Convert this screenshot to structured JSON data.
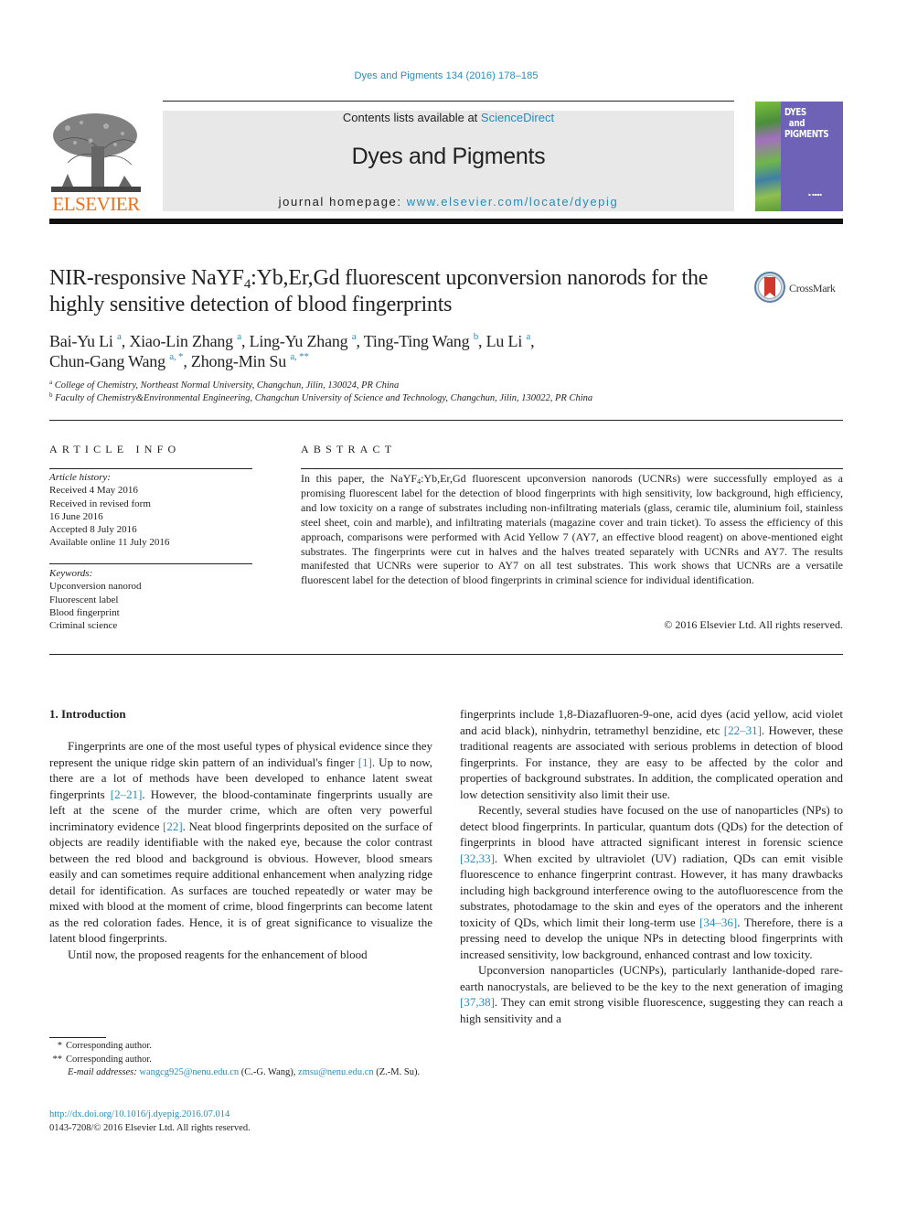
{
  "header": {
    "journal_citation": "Dyes and Pigments 134 (2016) 178–185",
    "contents_prefix": "Contents lists available at ",
    "contents_link": "ScienceDirect",
    "journal_name": "Dyes and Pigments",
    "homepage_prefix": "journal homepage: ",
    "homepage_link": "www.elsevier.com/locate/dyepig",
    "publisher_logo_text": "ELSEVIER",
    "cover_title_lines": [
      "DYES",
      "and",
      "PIGMENTS"
    ],
    "crossmark_label": "CrossMark"
  },
  "article": {
    "title_part1": "NIR-responsive NaYF",
    "title_sub": "4",
    "title_part2": ":Yb,Er,Gd fluorescent upconversion nanorods for the highly sensitive detection of blood fingerprints",
    "authors": [
      {
        "name": "Bai-Yu Li",
        "sup": "a",
        "sep": ", "
      },
      {
        "name": "Xiao-Lin Zhang",
        "sup": "a",
        "sep": ", "
      },
      {
        "name": "Ling-Yu Zhang",
        "sup": "a",
        "sep": ", "
      },
      {
        "name": "Ting-Ting Wang",
        "sup": "b",
        "sep": ", "
      },
      {
        "name": "Lu Li",
        "sup": "a",
        "sep": ","
      },
      {
        "name": "Chun-Gang Wang",
        "sup": "a, *",
        "sep": ", "
      },
      {
        "name": "Zhong-Min Su",
        "sup": "a, **",
        "sep": ""
      }
    ],
    "affiliations": [
      {
        "mark": "a",
        "text": "College of Chemistry, Northeast Normal University, Changchun, Jilin, 130024, PR China"
      },
      {
        "mark": "b",
        "text": "Faculty of Chemistry&Environmental Engineering, Changchun University of Science and Technology, Changchun, Jilin, 130022, PR China"
      }
    ]
  },
  "article_info": {
    "heading": "ARTICLE INFO",
    "history_label": "Article history:",
    "history": [
      "Received 4 May 2016",
      "Received in revised form",
      "16 June 2016",
      "Accepted 8 July 2016",
      "Available online 11 July 2016"
    ],
    "keywords_label": "Keywords:",
    "keywords": [
      "Upconversion nanorod",
      "Fluorescent label",
      "Blood fingerprint",
      "Criminal science"
    ]
  },
  "abstract": {
    "heading": "ABSTRACT",
    "text_part1": "In this paper, the NaYF",
    "text_sub": "4",
    "text_part2": ":Yb,Er,Gd fluorescent upconversion nanorods (UCNRs) were successfully employed as a promising fluorescent label for the detection of blood fingerprints with high sensitivity, low background, high efficiency, and low toxicity on a range of substrates including non-infiltrating materials (glass, ceramic tile, aluminium foil, stainless steel sheet, coin and marble), and infiltrating materials (magazine cover and train ticket). To assess the efficiency of this approach, comparisons were performed with Acid Yellow 7 (AY7, an effective blood reagent) on above-mentioned eight substrates. The fingerprints were cut in halves and the halves treated separately with UCNRs and AY7. The results manifested that UCNRs were superior to AY7 on all test substrates. This work shows that UCNRs are a versatile fluorescent label for the detection of blood fingerprints in criminal science for individual identification.",
    "copyright": "© 2016 Elsevier Ltd. All rights reserved."
  },
  "body": {
    "section_heading": "1.  Introduction",
    "left_paragraphs": [
      [
        {
          "t": "Fingerprints are one of the most useful types of physical evidence since they represent the unique ridge skin pattern of an individual's finger "
        },
        {
          "ref": "[1]"
        },
        {
          "t": ". Up to now, there are a lot of methods have been developed to enhance latent sweat fingerprints "
        },
        {
          "ref": "[2–21]"
        },
        {
          "t": ". However, the blood-contaminate fingerprints usually are left at the scene of the murder crime, which are often very powerful incriminatory evidence "
        },
        {
          "ref": "[22]"
        },
        {
          "t": ". Neat blood fingerprints deposited on the surface of objects are readily identifiable with the naked eye, because the color contrast between the red blood and background is obvious. However, blood smears easily and can sometimes require additional enhancement when analyzing ridge detail for identification. As surfaces are touched repeatedly or water may be mixed with blood at the moment of crime, blood fingerprints can become latent as the red coloration fades. Hence, it is of great significance to visualize the latent blood fingerprints."
        }
      ],
      [
        {
          "t": "Until now, the proposed reagents for the enhancement of blood"
        }
      ]
    ],
    "right_paragraphs": [
      [
        {
          "t": "fingerprints include 1,8-Diazafluoren-9-one, acid dyes (acid yellow, acid violet and acid black), ninhydrin, tetramethyl benzidine, etc "
        },
        {
          "ref": "[22–31]"
        },
        {
          "t": ". However, these traditional reagents are associated with serious problems in detection of blood fingerprints. For instance, they are easy to be affected by the color and properties of background substrates. In addition, the complicated operation and low detection sensitivity also limit their use."
        }
      ],
      [
        {
          "t": "Recently, several studies have focused on the use of nanoparticles (NPs) to detect blood fingerprints. In particular, quantum dots (QDs) for the detection of fingerprints in blood have attracted significant interest in forensic science "
        },
        {
          "ref": "[32,33]"
        },
        {
          "t": ". When excited by ultraviolet (UV) radiation, QDs can emit visible fluorescence to enhance fingerprint contrast. However, it has many drawbacks including high background interference owing to the autofluorescence from the substrates, photodamage to the skin and eyes of the operators and the inherent toxicity of QDs, which limit their long-term use "
        },
        {
          "ref": "[34–36]"
        },
        {
          "t": ". Therefore, there is a pressing need to develop the unique NPs in detecting blood fingerprints with increased sensitivity, low background, enhanced contrast and low toxicity."
        }
      ],
      [
        {
          "t": "Upconversion nanoparticles (UCNPs), particularly lanthanide-doped rare-earth nanocrystals, are believed to be the key to the next generation of imaging "
        },
        {
          "ref": "[37,38]"
        },
        {
          "t": ". They can emit strong visible fluorescence, suggesting they can reach a high sensitivity and a"
        }
      ]
    ]
  },
  "footnotes": {
    "corresponding": [
      {
        "mark": "*",
        "text": "Corresponding author."
      },
      {
        "mark": "**",
        "text": "Corresponding author."
      }
    ],
    "email_label": "E-mail addresses:",
    "email1": "wangcg925@nenu.edu.cn",
    "email1_owner": " (C.-G. Wang), ",
    "email2": "zmsu@nenu.edu.cn",
    "email2_owner": " (Z.-M. Su).",
    "doi_link": "http://dx.doi.org/10.1016/j.dyepig.2016.07.014",
    "issn_line": "0143-7208/© 2016 Elsevier Ltd. All rights reserved."
  },
  "colors": {
    "link": "#2a8ab8",
    "elsevier_orange": "#e9711c",
    "masthead_gray": "#e8e8e8",
    "cover_purple": "#6d62b5"
  }
}
